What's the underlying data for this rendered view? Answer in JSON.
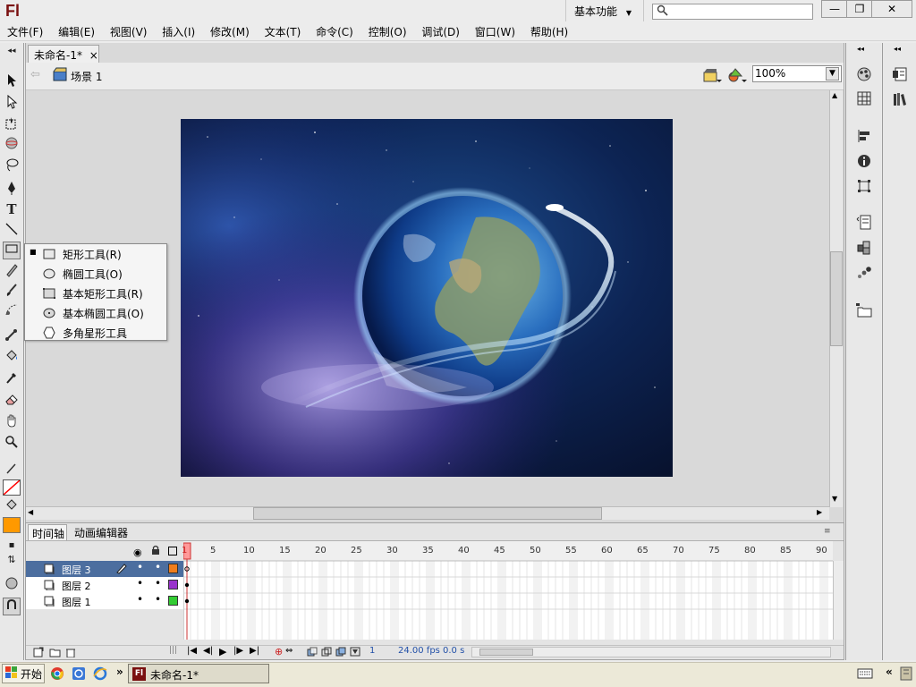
{
  "app": {
    "logo": "Fl",
    "workspace": "基本功能",
    "search_placeholder": "",
    "win_buttons": {
      "minimize": "—",
      "maximize": "❐",
      "close": "✕"
    }
  },
  "menu": [
    "文件(F)",
    "编辑(E)",
    "视图(V)",
    "插入(I)",
    "修改(M)",
    "文本(T)",
    "命令(C)",
    "控制(O)",
    "调试(D)",
    "窗口(W)",
    "帮助(H)"
  ],
  "document": {
    "tab_title": "未命名-1*",
    "tab_close": "×",
    "scene": "场景 1",
    "zoom": "100%"
  },
  "tool_flyout": {
    "selected_marker": "■",
    "items": [
      {
        "label": "矩形工具(R)",
        "icon": "rectangle-icon"
      },
      {
        "label": "椭圆工具(O)",
        "icon": "oval-icon"
      },
      {
        "label": "基本矩形工具(R)",
        "icon": "primitive-rectangle-icon"
      },
      {
        "label": "基本椭圆工具(O)",
        "icon": "primitive-oval-icon"
      },
      {
        "label": "多角星形工具",
        "icon": "polystar-icon"
      }
    ]
  },
  "timeline": {
    "tabs": [
      "时间轴",
      "动画编辑器"
    ],
    "layers": [
      {
        "name": "图层 3",
        "color": "#f07d1b",
        "selected": true
      },
      {
        "name": "图层 2",
        "color": "#9933cc",
        "selected": false
      },
      {
        "name": "图层 1",
        "color": "#33cc33",
        "selected": false
      }
    ],
    "frame_labels": [
      "1",
      "5",
      "10",
      "15",
      "20",
      "25",
      "30",
      "35",
      "40",
      "45",
      "50",
      "55",
      "60",
      "65",
      "70",
      "75",
      "80",
      "85",
      "90"
    ],
    "current_frame": "1",
    "fps": "24.00 fps",
    "time": "0.0 s"
  },
  "taskbar": {
    "start": "开始",
    "chevron": "»",
    "task": "未命名-1*",
    "tray_chevron": "«"
  },
  "colors": {
    "stroke": "#ff0000",
    "fill": "#ff9900",
    "playhead": "#ff4444"
  }
}
